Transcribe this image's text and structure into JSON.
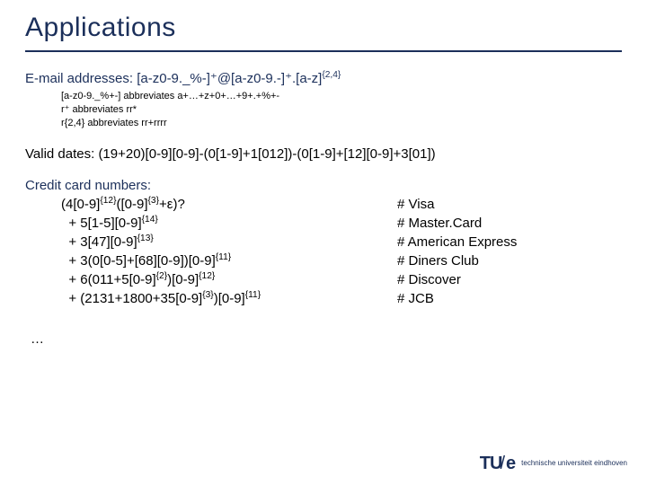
{
  "title": "Applications",
  "email": {
    "heading_prefix": "E-mail addresses: ",
    "heading_regex": "[a-z0-9._%-]⁺@[a-z0-9.-]⁺.[a-z]",
    "heading_suffix": "{2,4}",
    "lines": [
      "[a-z0-9._%+-] abbreviates a+…+z+0+…+9+.+%+-",
      "r⁺ abbreviates rr*",
      "r{2,4} abbreviates rr+rrrr"
    ]
  },
  "valid_dates": "Valid dates: (19+20)[0-9][0-9]-(0[1-9]+1[012])-(0[1-9]+[12][0-9]+3[01])",
  "cc": {
    "heading": "Credit card numbers:",
    "left": [
      "(4[0-9]{12}([0-9]{3}+ε)?",
      "  + 5[1-5][0-9]{14}",
      "  + 3[47][0-9]{13}",
      "  + 3(0[0-5]+[68][0-9])[0-9]{11}",
      "  + 6(011+5[0-9]{2})[0-9]{12}",
      "  + (2131+1800+35[0-9]{3})[0-9]{11}"
    ],
    "right": [
      "# Visa",
      "# Master.Card",
      "# American Express",
      "# Diners Club",
      "# Discover",
      "# JCB"
    ]
  },
  "ellipsis": "…",
  "footer": {
    "logo_t": "TU",
    "logo_slash": "/",
    "logo_e": "e",
    "sub1": "technische universiteit eindhoven"
  }
}
